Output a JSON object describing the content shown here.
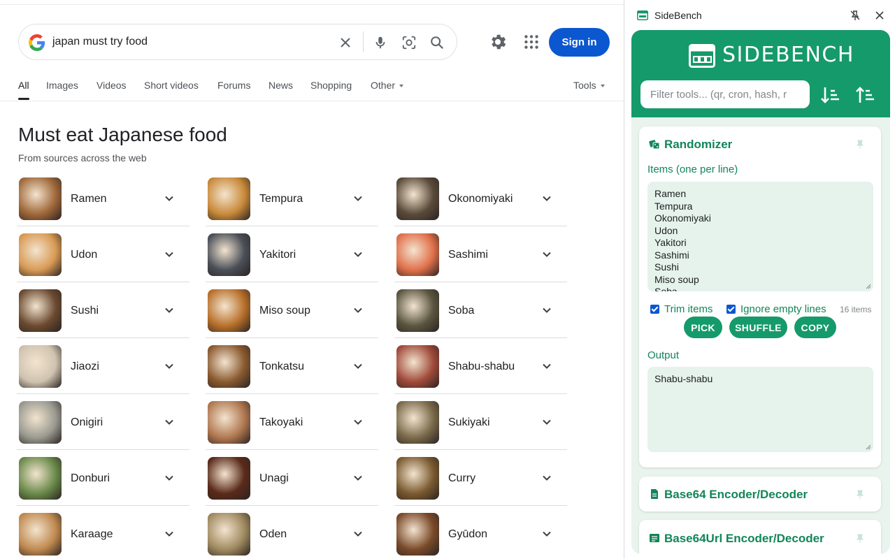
{
  "search": {
    "query": "japan must try food",
    "signin_label": "Sign in",
    "tabs": [
      {
        "label": "All"
      },
      {
        "label": "Images"
      },
      {
        "label": "Videos"
      },
      {
        "label": "Short videos"
      },
      {
        "label": "Forums"
      },
      {
        "label": "News"
      },
      {
        "label": "Shopping"
      },
      {
        "label": "Other"
      }
    ],
    "tools_label": "Tools",
    "heading": "Must eat Japanese food",
    "subheading": "From sources across the web",
    "foods": [
      {
        "name": "Ramen",
        "color": "#a0683a"
      },
      {
        "name": "Tempura",
        "color": "#c98a3a"
      },
      {
        "name": "Okonomiyaki",
        "color": "#5a4a3a"
      },
      {
        "name": "Udon",
        "color": "#d89a55"
      },
      {
        "name": "Yakitori",
        "color": "#4a4f58"
      },
      {
        "name": "Sashimi",
        "color": "#e0704a"
      },
      {
        "name": "Sushi",
        "color": "#6b4a30"
      },
      {
        "name": "Miso soup",
        "color": "#b8702a"
      },
      {
        "name": "Soba",
        "color": "#5a5540"
      },
      {
        "name": "Jiaozi",
        "color": "#cfc3b0"
      },
      {
        "name": "Tonkatsu",
        "color": "#8a5a30"
      },
      {
        "name": "Shabu-shabu",
        "color": "#a04a3a"
      },
      {
        "name": "Onigiri",
        "color": "#9a9a90"
      },
      {
        "name": "Takoyaki",
        "color": "#b07850"
      },
      {
        "name": "Sukiyaki",
        "color": "#7a6a4a"
      },
      {
        "name": "Donburi",
        "color": "#6a8a4a"
      },
      {
        "name": "Unagi",
        "color": "#5a2a1a"
      },
      {
        "name": "Curry",
        "color": "#7a5a30"
      },
      {
        "name": "Karaage",
        "color": "#c08a50"
      },
      {
        "name": "Oden",
        "color": "#a08a60"
      },
      {
        "name": "Gyūdon",
        "color": "#7a4a2a"
      }
    ]
  },
  "sidebench": {
    "app_title": "SideBench",
    "brand": "SIDEBENCH",
    "filter_placeholder": "Filter tools... (qr, cron, hash, r",
    "randomizer": {
      "title": "Randomizer",
      "items_label": "Items (one per line)",
      "items": [
        "Ramen",
        "Tempura",
        "Okonomiyaki",
        "Udon",
        "Yakitori",
        "Sashimi",
        "Sushi",
        "Miso soup",
        "Soba"
      ],
      "trim_label": "Trim items",
      "ignore_label": "Ignore empty lines",
      "count": "16 items",
      "pick_label": "PICK",
      "shuffle_label": "SHUFFLE",
      "copy_label": "COPY",
      "output_label": "Output",
      "output_value": "Shabu-shabu"
    },
    "base64": {
      "title": "Base64 Encoder/Decoder"
    },
    "base64url": {
      "title": "Base64Url Encoder/Decoder"
    },
    "accent_color": "#159a6b"
  }
}
